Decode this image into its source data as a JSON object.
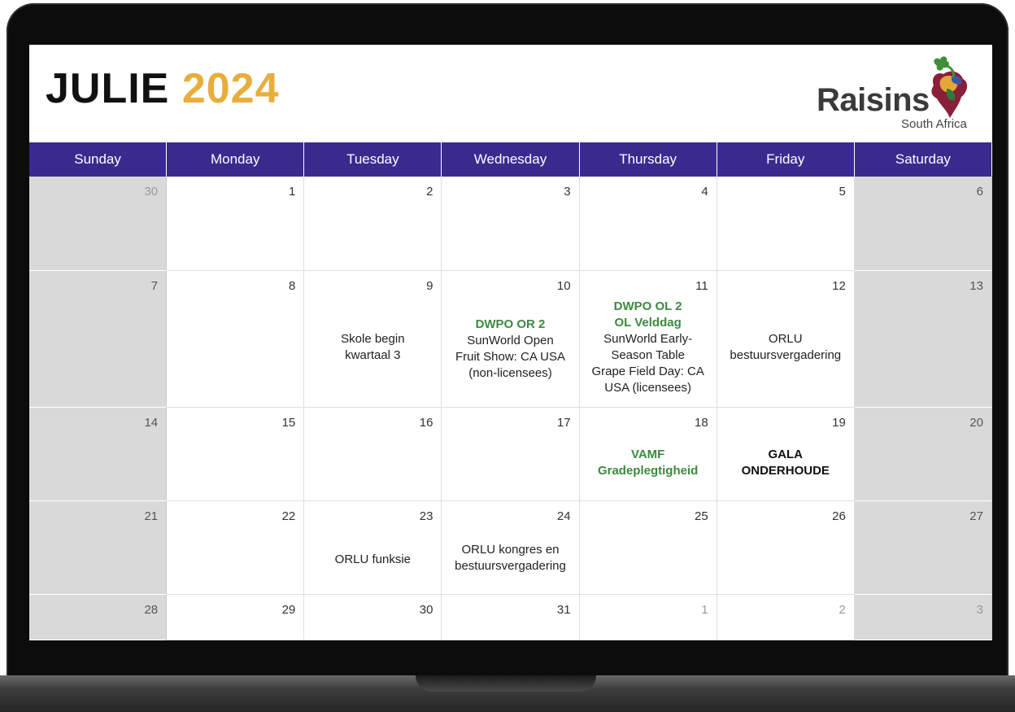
{
  "title": {
    "month": "JULIE",
    "year": "2024"
  },
  "logo": {
    "name": "Raisins",
    "sub": "South Africa"
  },
  "weekdays": [
    "Sunday",
    "Monday",
    "Tuesday",
    "Wednesday",
    "Thursday",
    "Friday",
    "Saturday"
  ],
  "colors": {
    "header": "#3a2a8e",
    "year": "#e8ae3b",
    "event_green": "#3c8a3f",
    "weekend": "#d9d9d9"
  },
  "weeks": [
    [
      {
        "day": "30",
        "events": []
      },
      {
        "day": "1",
        "events": []
      },
      {
        "day": "2",
        "events": []
      },
      {
        "day": "3",
        "events": []
      },
      {
        "day": "4",
        "events": []
      },
      {
        "day": "5",
        "events": []
      },
      {
        "day": "6",
        "events": []
      }
    ],
    [
      {
        "day": "7",
        "events": []
      },
      {
        "day": "8",
        "events": []
      },
      {
        "day": "9",
        "events": [
          "Skole begin",
          "kwartaal 3"
        ]
      },
      {
        "day": "10",
        "events": [
          "DWPO OR 2",
          "SunWorld Open",
          "Fruit Show: CA USA",
          "(non-licensees)"
        ]
      },
      {
        "day": "11",
        "events": [
          "DWPO OL 2",
          "OL Velddag",
          "SunWorld Early-",
          "Season Table",
          "Grape Field Day: CA",
          "USA (licensees)"
        ]
      },
      {
        "day": "12",
        "events": [
          "ORLU",
          "bestuursvergadering"
        ]
      },
      {
        "day": "13",
        "events": []
      }
    ],
    [
      {
        "day": "14",
        "events": []
      },
      {
        "day": "15",
        "events": []
      },
      {
        "day": "16",
        "events": []
      },
      {
        "day": "17",
        "events": []
      },
      {
        "day": "18",
        "events": [
          "VAMF",
          "Gradeplegtigheid"
        ]
      },
      {
        "day": "19",
        "events": [
          "GALA",
          "ONDERHOUDE"
        ]
      },
      {
        "day": "20",
        "events": []
      }
    ],
    [
      {
        "day": "21",
        "events": []
      },
      {
        "day": "22",
        "events": []
      },
      {
        "day": "23",
        "events": [
          "ORLU funksie"
        ]
      },
      {
        "day": "24",
        "events": [
          "ORLU kongres en",
          "bestuursvergadering"
        ]
      },
      {
        "day": "25",
        "events": []
      },
      {
        "day": "26",
        "events": []
      },
      {
        "day": "27",
        "events": []
      }
    ],
    [
      {
        "day": "28",
        "events": []
      },
      {
        "day": "29",
        "events": []
      },
      {
        "day": "30",
        "events": []
      },
      {
        "day": "31",
        "events": []
      },
      {
        "day": "1",
        "events": []
      },
      {
        "day": "2",
        "events": []
      },
      {
        "day": "3",
        "events": []
      }
    ]
  ]
}
